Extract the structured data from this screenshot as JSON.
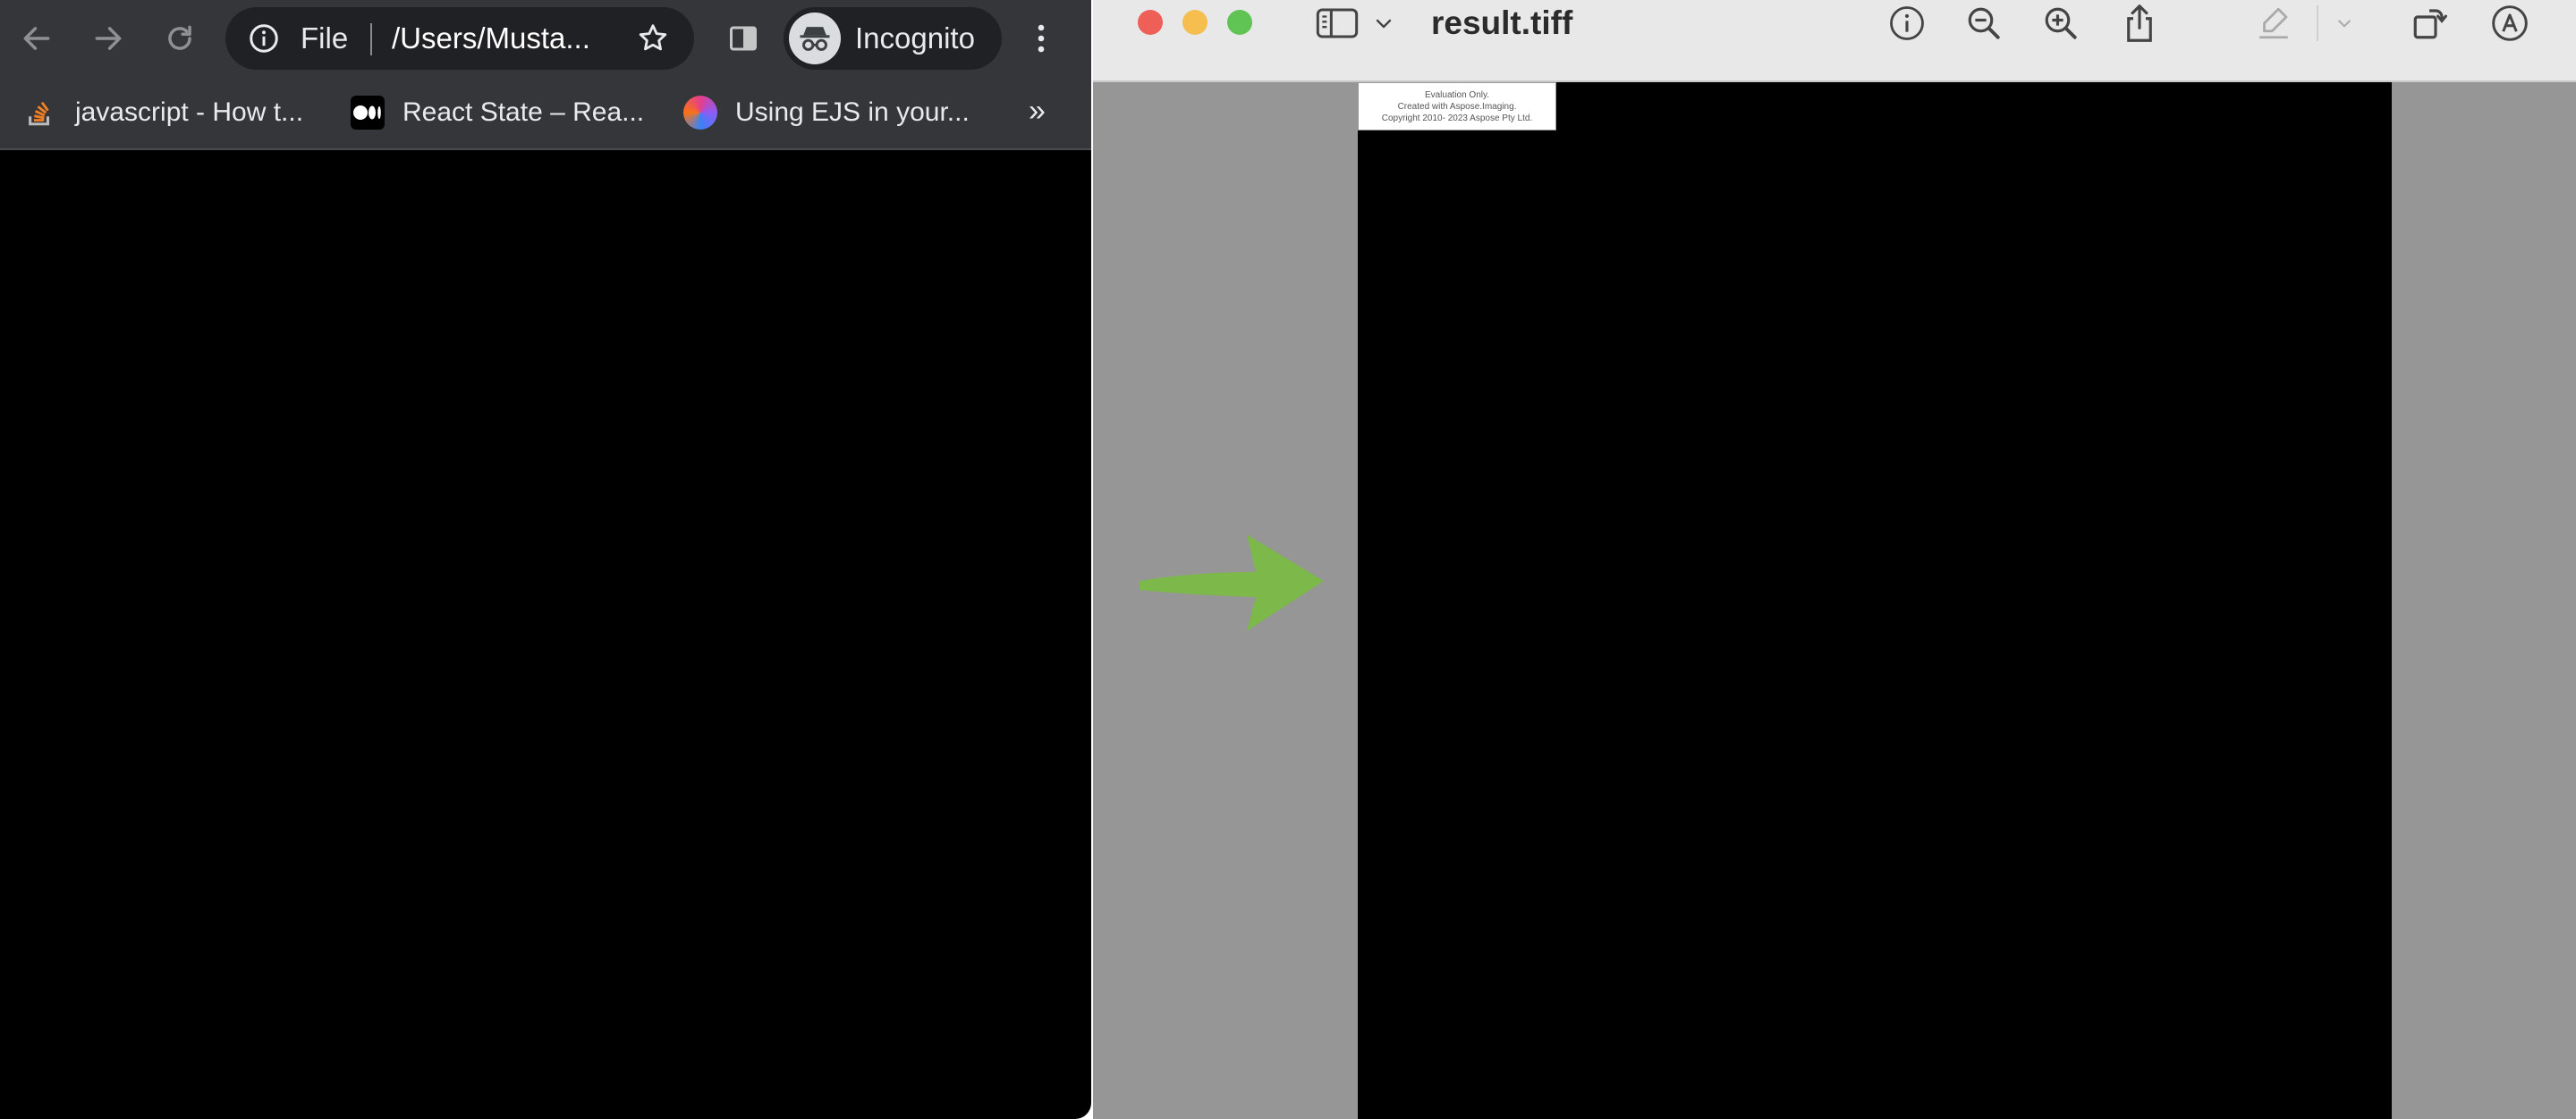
{
  "chrome": {
    "omnibox": {
      "scheme_label": "File",
      "url": "/Users/Musta..."
    },
    "profile_label": "Incognito",
    "bookmarks": [
      {
        "label": "javascript - How t..."
      },
      {
        "label": "React State – Rea..."
      },
      {
        "label": "Using EJS in your..."
      }
    ],
    "bookmarks_more": "»"
  },
  "preview": {
    "title": "result.tiff",
    "watermark": [
      "Evaluation Only.",
      "Created with Aspose.Imaging.",
      "Copyright 2010- 2023 Aspose Pty Ltd."
    ]
  },
  "colors": {
    "arrow": "#7cb84a",
    "traffic_close": "#ee5f57",
    "traffic_minimize": "#f5be4f",
    "traffic_zoom": "#5fc454"
  }
}
